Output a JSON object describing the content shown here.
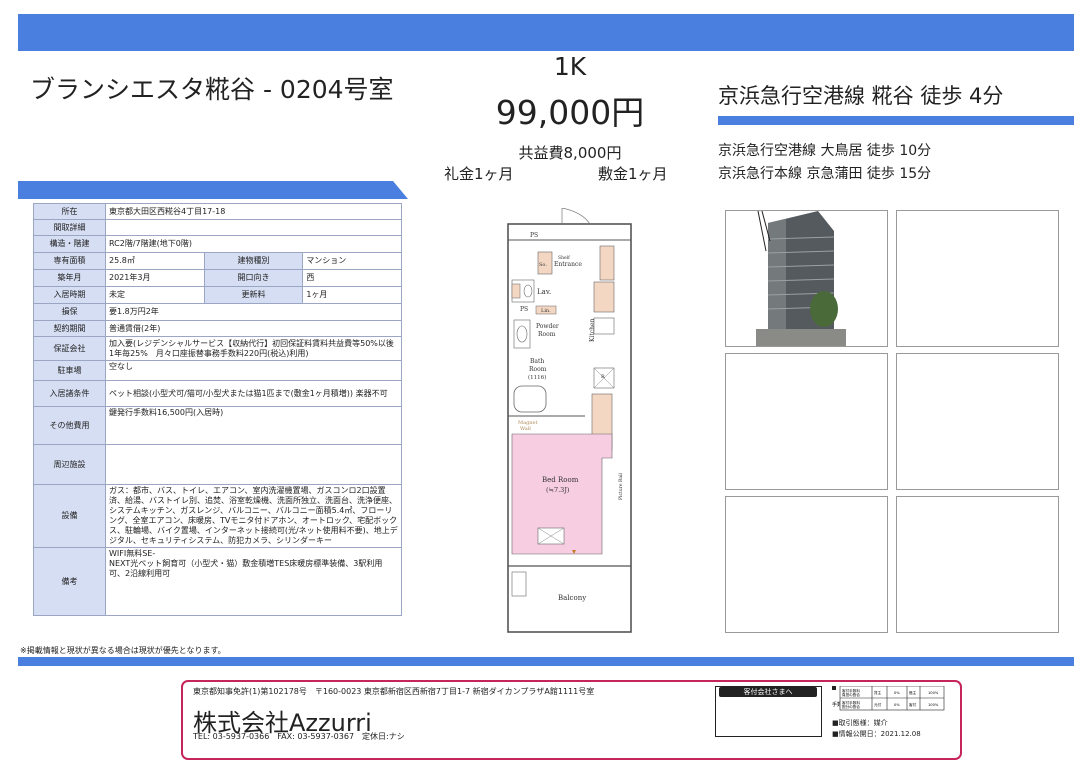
{
  "header": {
    "property_name": "ブランシエスタ糀谷 - 0204号室",
    "layout_type": "1K",
    "rent": "99,000円",
    "common_fee": "共益費8,000円",
    "reikin": "礼金1ヶ月",
    "shikikin": "敷金1ヶ月",
    "main_station": "京浜急行空港線 糀谷 徒歩 4分",
    "sub_stations": [
      "京浜急行空港線 大鳥居 徒歩 10分",
      "京浜急行本線 京急蒲田 徒歩 15分"
    ]
  },
  "spec": {
    "address_label": "所在",
    "address": "東京都大田区西糀谷4丁目17-18",
    "layout_detail_label": "間取詳細",
    "layout_detail": "",
    "structure_label": "構造・階建",
    "structure": "RC2階/7階建(地下0階)",
    "area_label": "専有面積",
    "area": "25.8㎡",
    "building_type_label": "建物種別",
    "building_type": "マンション",
    "built_label": "築年月",
    "built": "2021年3月",
    "facing_label": "開口向き",
    "facing": "西",
    "move_in_label": "入居時期",
    "move_in": "未定",
    "renewal_label": "更新料",
    "renewal": "1ヶ月",
    "insurance_label": "損保",
    "insurance": "要1.8万円2年",
    "contract_label": "契約期間",
    "contract": "普通賃借(2年)",
    "guarantor_label": "保証会社",
    "guarantor": "加入要(レジデンシャルサービス【収納代行】初回保証料賃料共益費等50%以後1年毎25%　月々口座振替事務手数料220円(税込)利用)",
    "parking_label": "駐車場",
    "parking": "空なし",
    "conditions_label": "入居諸条件",
    "conditions": "ペット相談(小型犬可/猫可/小型犬または猫1匹まで(敷金1ヶ月積増)) 楽器不可",
    "other_fees_label": "その他費用",
    "other_fees": "鍵発行手数料16,500円(入居時)",
    "surroundings_label": "周辺施設",
    "surroundings": "",
    "equipment_label": "設備",
    "equipment": "ガス：都市、バス、トイレ、エアコン、室内洗濯機置場、ガスコンロ2口設置済、給湯、バストイレ別、追焚、浴室乾燥機、洗面所独立、洗面台、洗浄便座、システムキッチン、ガスレンジ、バルコニー、バルコニー面積5.4㎡、フローリング、全室エアコン、床暖房、TVモニタ付ドアホン、オートロック、宅配ボックス、駐輪場、バイク置場、インターネット接続可(光/ネット使用料不要)、地上デジタル、セキュリティシステム、防犯カメラ、シリンダーキー",
    "remarks_label": "備考",
    "remarks": "WIFI無料SE-\nNEXT光ペット飼育可（小型犬・猫）敷金積増TES床暖房標準装備、3駅利用可、2沿線利用可"
  },
  "notice": "※掲載情報と現状が異なる場合は現状が優先となります。",
  "floorplan": {
    "ps_top": "PS",
    "shelf": "Shelf",
    "shoes": "So.",
    "entrance": "Entrance",
    "lav": "Lav.",
    "ps_mid": "PS",
    "lin": "Lin.",
    "powder": "Powder",
    "room": "Room",
    "bath": "Bath",
    "bath_room": "Room",
    "bath_size": "(1116)",
    "kitchen": "Kitchen",
    "r_mark": "R",
    "magnet": "Magnet",
    "wall": "Wall",
    "bedroom": "Bed Room",
    "bedroom_size": "(≒7.3J)",
    "picture_rail": "Picture Rail",
    "balcony": "Balcony"
  },
  "footer": {
    "license_line": "東京都知事免許(1)第102178号　〒160-0023 東京都新宿区西新宿7丁目1-7 新宿ダイカンプラザA館1111号室",
    "company": "株式会社Azzurri",
    "contact_line": "TEL: 03-5937-0366　FAX: 03-5937-0367　定休日:ナシ",
    "stamp_label": "客付会社さまへ",
    "fee_row1_a": "客付手数料",
    "fee_row1_b": "負担の割合",
    "fee_row1_c": "貸主",
    "fee_row1_d": "0%",
    "fee_row1_e": "借主",
    "fee_row1_f": "100%",
    "fee_row2_a": "客付手数料",
    "fee_row2_b": "配分の割合",
    "fee_row2_c": "元付",
    "fee_row2_d": "0%",
    "fee_row2_e": "客付",
    "fee_row2_f": "100%",
    "fee_side": "手数料",
    "transaction": "■取引態様：媒介",
    "published": "■情報公開日：2021.12.08"
  },
  "colors": {
    "accent": "#4a7fe0",
    "footer_border": "#c6245c",
    "table_header": "#d6def3",
    "bedroom": "#f7cde2"
  }
}
